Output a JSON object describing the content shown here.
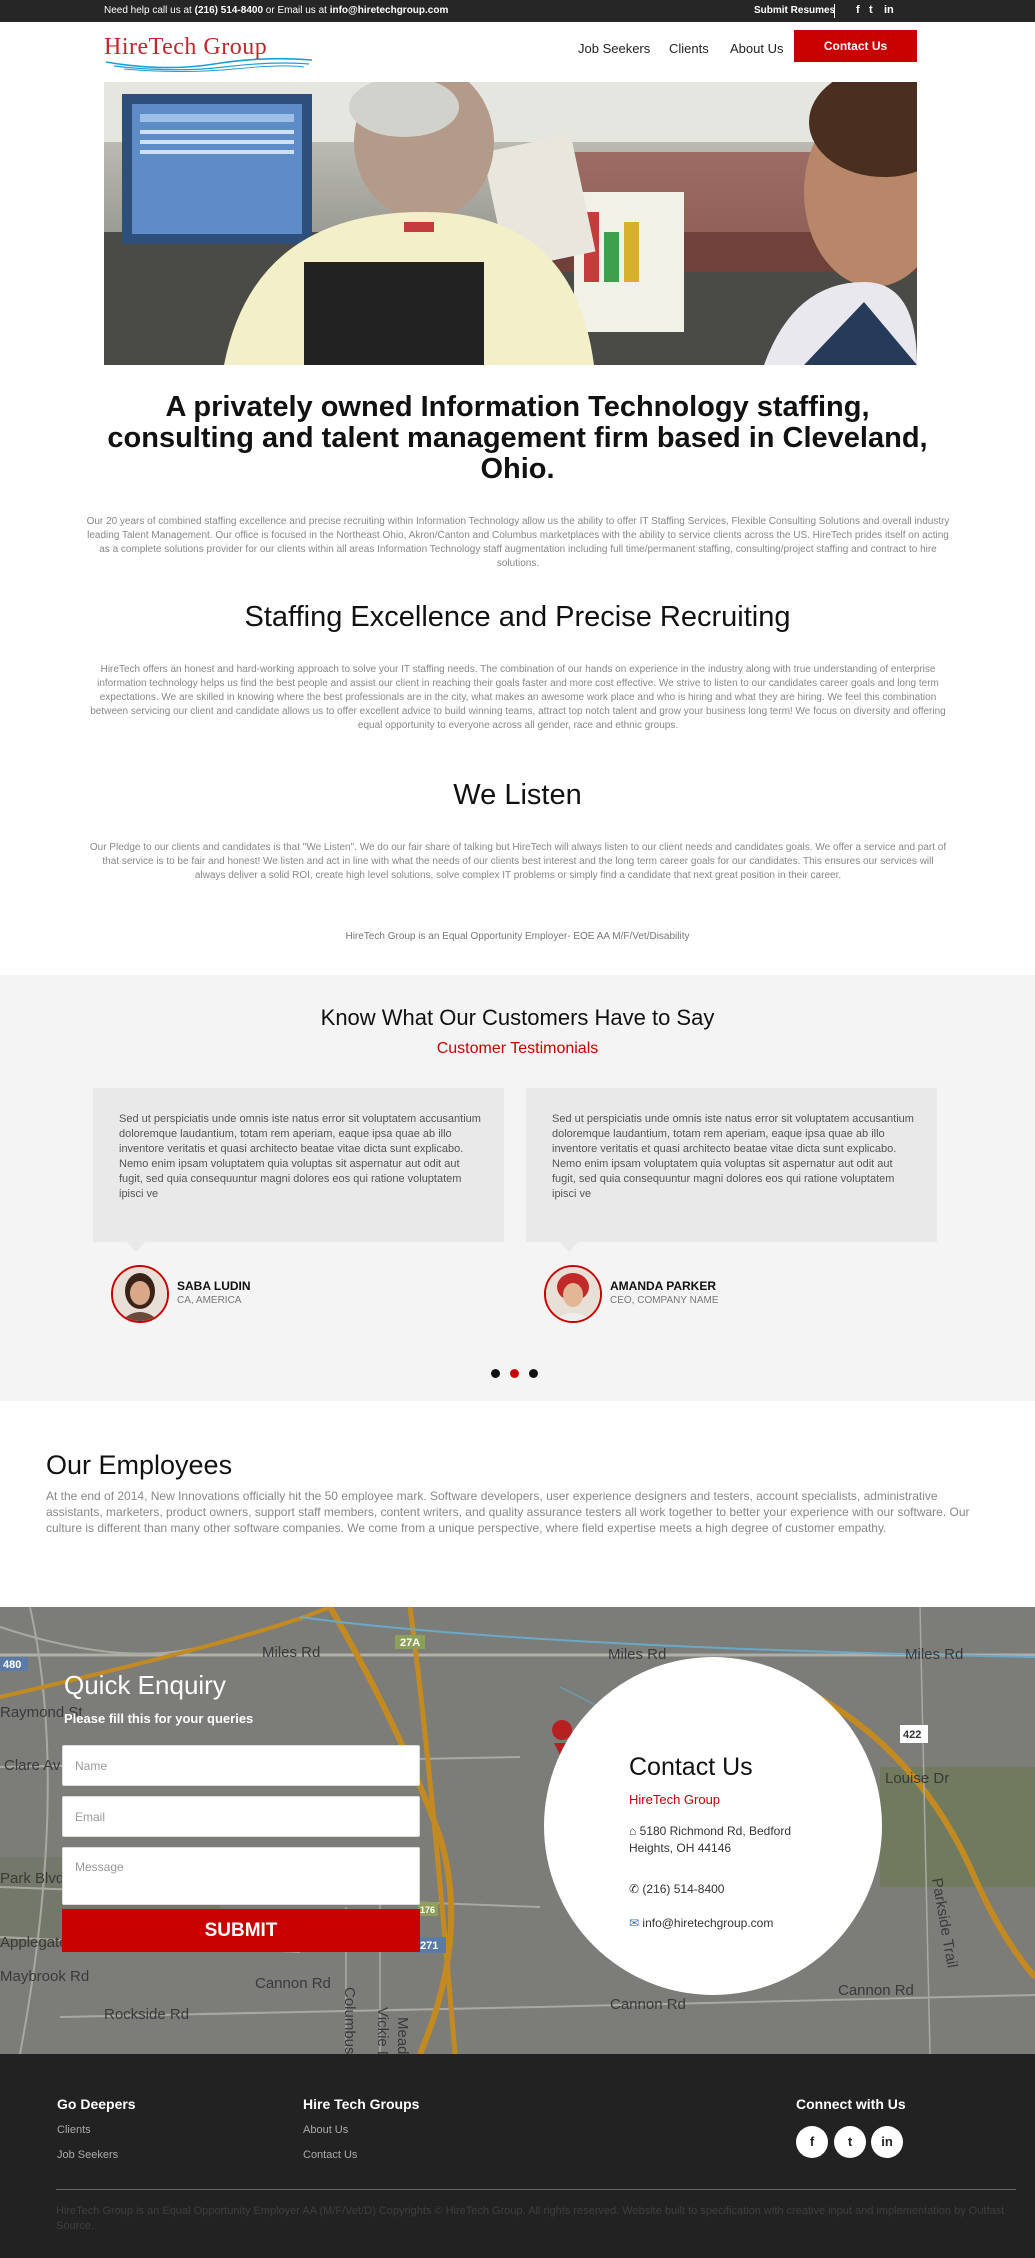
{
  "topbar": {
    "help_prefix": "Need help call us at ",
    "phone": "(216) 514-8400",
    "help_mid": " or Email us at ",
    "email": "info@hiretechgroup.com",
    "submit_resumes": "Submit Resumes",
    "social": {
      "facebook": "f",
      "twitter": "t",
      "linkedin": "in"
    }
  },
  "header": {
    "logo_text": "HireTech Group",
    "nav": {
      "job_seekers": "Job Seekers",
      "clients": "Clients",
      "about": "About Us"
    },
    "contact_button": "Contact Us"
  },
  "intro": {
    "heading": "A privately owned Information Technology staffing, consulting and talent management firm based in Cleveland, Ohio.",
    "paragraph": "Our 20 years of combined staffing excellence and precise recruiting within Information Technology allow us the ability to offer IT Staffing Services, Flexible Consulting Solutions and overall industry leading Talent Management. Our office is focused in the Northeast Ohio, Akron/Canton and Columbus marketplaces with the ability to service clients across the US. HireTech prides itself on acting as a complete solutions provider for our clients within all areas Information Technology staff augmentation including full time/permanent staffing, consulting/project staffing and contract to hire solutions."
  },
  "staffing": {
    "heading": "Staffing Excellence and Precise Recruiting",
    "paragraph": "HireTech offers an honest and hard-working approach to solve your IT staffing needs. The combination of our hands on experience in the industry along with true understanding of enterprise information technology helps us find the best people and assist our client in reaching their goals faster and more cost effective. We strive to listen to our candidates career goals and long term expectations. We are skilled in knowing where the best professionals are in the city, what makes an awesome work place and who is hiring and what they are hiring. We feel this combination between servicing our client and candidate allows us to offer excellent advice to build winning teams, attract top notch talent and grow your business long term! We focus on diversity and offering equal opportunity to everyone across all gender, race and ethnic groups."
  },
  "listen": {
    "heading": "We Listen",
    "paragraph": "Our Pledge to our clients and candidates is that \"We Listen\". We do our fair share of talking but HireTech will always listen to our client needs and candidates goals. We offer a service and part of that service is to be fair and honest! We listen and act in line with what the needs of our clients best interest and the long term career goals for our candidates. This ensures our services will always deliver a solid ROI, create high level solutions, solve complex IT problems or simply find a candidate that next great position in their career."
  },
  "eoe": "HireTech Group is an Equal Opportunity Employer- EOE AA M/F/Vet/Disability",
  "testimonials": {
    "title": "Know What Our Customers Have to Say",
    "subtitle": "Customer Testimonials",
    "items": [
      {
        "quote": "Sed ut perspiciatis unde omnis iste natus error sit voluptatem accusantium doloremque laudantium, totam rem aperiam, eaque ipsa quae ab illo inventore veritatis et quasi architecto beatae vitae dicta sunt explicabo. Nemo enim ipsam voluptatem quia voluptas sit aspernatur aut odit aut fugit, sed quia consequuntur magni dolores eos qui ratione voluptatem ipisci ve",
        "name": "SABA LUDIN",
        "role": "CA, AMERICA"
      },
      {
        "quote": "Sed ut perspiciatis unde omnis iste natus error sit voluptatem accusantium doloremque laudantium, totam rem aperiam, eaque ipsa quae ab illo inventore veritatis et quasi architecto beatae vitae dicta sunt explicabo. Nemo enim ipsam voluptatem quia voluptas sit aspernatur aut odit aut fugit, sed quia consequuntur magni dolores eos qui ratione voluptatem ipisci ve",
        "name": "AMANDA PARKER",
        "role": "CEO, COMPANY NAME"
      }
    ],
    "active_dot": 2
  },
  "employees": {
    "title": "Our Employees",
    "text": "At the end of 2014, New Innovations officially hit the 50 employee mark. Software developers, user experience designers and testers, account specialists, administrative assistants, marketers, product owners, support staff members, content writers, and quality assurance testers all work together to better your experience with our software. Our culture is different than many other software companies. We come from a unique perspective, where field expertise meets a high degree of customer empathy."
  },
  "enquiry": {
    "title": "Quick Enquiry",
    "subtitle": "Please fill this for your queries",
    "name_placeholder": "Name",
    "email_placeholder": "Email",
    "message_placeholder": "Message",
    "submit": "SUBMIT"
  },
  "map_labels": [
    "Miles Rd",
    "Miles Rd",
    "Miles Rd",
    "Clare Av",
    "Raymond St",
    "Park Blvd",
    "Applegate Rd",
    "Maybrook Rd",
    "Rockside Rd",
    "Cannon Rd",
    "Cannon Rd",
    "Cannon Rd",
    "Parkside Trail",
    "Columbus Rd",
    "Vickie Dr",
    "Meadow Dr",
    "Louise Dr",
    "27A",
    "480",
    "422",
    "271",
    "176"
  ],
  "contact": {
    "title": "Contact Us",
    "firm": "HireTech Group",
    "address": "5180 Richmond Rd, Bedford Heights, OH 44146",
    "phone": "(216) 514-8400",
    "email": "info@hiretechgroup.com"
  },
  "footer": {
    "col1_title": "Go Deepers",
    "col1_links": [
      "Clients",
      "Job Seekers"
    ],
    "col2_title": "Hire Tech Groups",
    "col2_links": [
      "About Us",
      "Contact Us"
    ],
    "col3_title": "Connect with Us",
    "social": {
      "facebook": "f",
      "twitter": "t",
      "linkedin": "in"
    },
    "copyright": "HireTech Group is an Equal Opportunity Employer AA (M/F/Vet/D) Copyrights © HireTech Group. All rights reserved. Website built to specification with creative input and implementation by Outfast Source."
  },
  "colors": {
    "accent": "#c80000",
    "topbar": "#262626",
    "footer": "#222222",
    "panel": "#f4f4f4"
  }
}
